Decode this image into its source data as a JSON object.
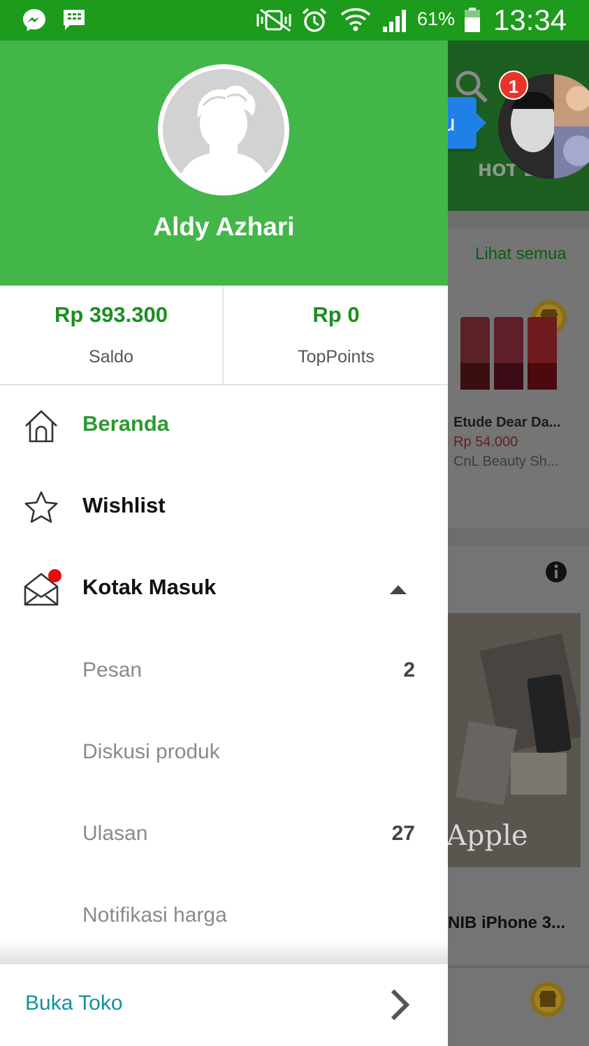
{
  "status_bar": {
    "icons": [
      "messenger-icon",
      "bbm-icon",
      "nfc-mute-icon",
      "alarm-icon",
      "wifi-icon",
      "signal-icon",
      "battery-icon"
    ],
    "battery": "61%",
    "time": "13:34"
  },
  "chat_head": {
    "badge": "1",
    "bubble": "Do: Huhuhu"
  },
  "background_app": {
    "hot_list": "HOT LIST",
    "see_all": "Lihat semua",
    "product_title": "Etude Dear Da...",
    "product_price": "Rp 54.000",
    "product_shop": "CnL Beauty Sh...",
    "banner_brand": "Apple",
    "product2_title": "NIB iPhone 3..."
  },
  "profile": {
    "name": "Aldy Azhari"
  },
  "balances": {
    "saldo_value": "Rp 393.300",
    "saldo_label": "Saldo",
    "points_value": "Rp 0",
    "points_label": "TopPoints"
  },
  "menu": {
    "beranda": "Beranda",
    "wishlist": "Wishlist",
    "kotak_masuk": "Kotak Masuk",
    "sub": [
      {
        "label": "Pesan",
        "count": "2"
      },
      {
        "label": "Diskusi produk",
        "count": ""
      },
      {
        "label": "Ulasan",
        "count": "27"
      },
      {
        "label": "Notifikasi harga",
        "count": ""
      }
    ]
  },
  "footer": {
    "buka_toko": "Buka Toko"
  },
  "colors": {
    "status_bar": "#1c9b1c",
    "header_green": "#42b649",
    "active_green": "#2c9a33",
    "teal_link": "#12919c",
    "chat_bubble": "#1f80e8",
    "notification_red": "#e80b0b"
  }
}
